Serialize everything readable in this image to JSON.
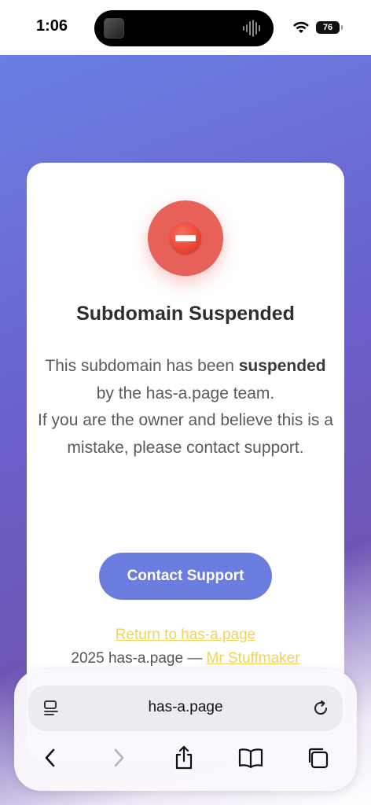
{
  "status_bar": {
    "time": "1:06",
    "battery": "76"
  },
  "card": {
    "title": "Subdomain Suspended",
    "body_pre": "This subdomain has been",
    "body_bold": "suspended",
    "body_post": "by the has-a.page team.",
    "body_line2": "If you are the owner and believe this is a mistake, please contact support.",
    "contact_button": "Contact Support",
    "return_link": "Return to has-a.page",
    "footer_text": "2025 has-a.page —",
    "footer_link": "Mr Stuffmaker"
  },
  "browser": {
    "url": "has-a.page"
  },
  "colors": {
    "accent": "#6b7ee0",
    "error": "#e8605a",
    "link": "#f2d35a"
  },
  "icons": [
    "reader-icon",
    "reload-icon",
    "back-icon",
    "forward-icon",
    "share-icon",
    "bookmarks-icon",
    "tabs-icon",
    "no-entry-icon",
    "wifi-icon"
  ]
}
